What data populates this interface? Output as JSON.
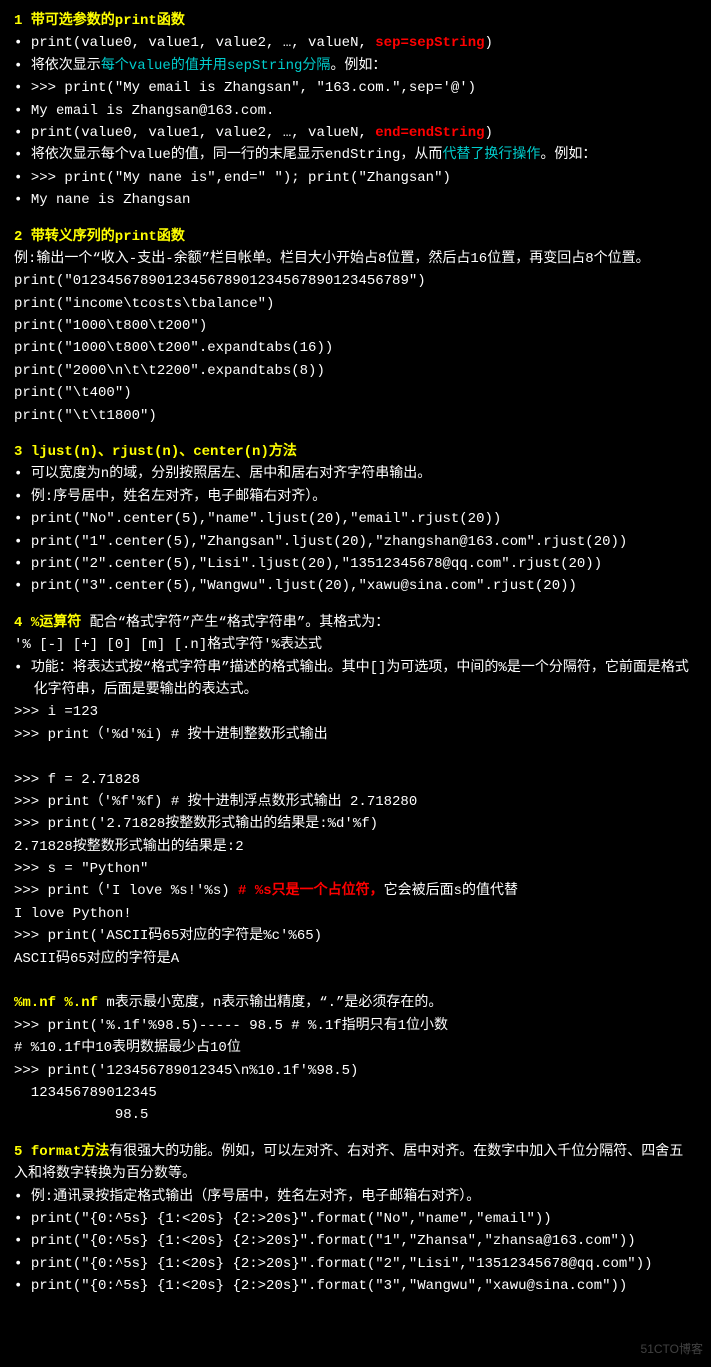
{
  "sec1": {
    "title_num": "1",
    "title_text": "带可选参数的print函数",
    "b1a": "print(value0, value1, value2, …, valueN, ",
    "b1b": "sep=sepString",
    "b1c": ")",
    "b2a": "将依次显示",
    "b2b": "每个value的值并用sepString分隔",
    "b2c": "。例如：",
    "b3": ">>> print(\"My email is Zhangsan\", \"163.com.\",sep='@')",
    "b4": "My email is Zhangsan@163.com.",
    "b5a": "print(value0, value1, value2, …, valueN, ",
    "b5b": "end=endString",
    "b5c": ")",
    "b6a": "将依次显示每个value的值，同一行的末尾显示endString，从而",
    "b6b": "代替了换行操作",
    "b6c": "。例如：",
    "b7": ">>> print(\"My nane is\",end=\" \"); print(\"Zhangsan\")",
    "b8": "My nane is Zhangsan"
  },
  "sec2": {
    "title_num": "2",
    "title_text": "带转义序列的print函数",
    "l1": "例:输出一个“收入-支出-余额”栏目帐单。栏目大小开始占8位置，然后占16位置，再变回占8个位置。print(\"0123456789012345678901234567890123456789\")",
    "l2": "print(\"income\\tcosts\\tbalance\")",
    "l3": "print(\"1000\\t800\\t200\")",
    "l4": "print(\"1000\\t800\\t200\".expandtabs(16))",
    "l5": "print(\"2000\\n\\t\\t2200\".expandtabs(8))",
    "l6": "print(\"\\t400\")",
    "l7": "print(\"\\t\\t1800\")"
  },
  "sec3": {
    "title_num": "3",
    "title_text": "ljust(n)、rjust(n)、center(n)方法",
    "b1": "可以宽度为n的域，分别按照居左、居中和居右对齐字符串输出。",
    "b2": "例:序号居中，姓名左对齐，电子邮箱右对齐）。",
    "b3": "print(\"No\".center(5),\"name\".ljust(20),\"email\".rjust(20))",
    "b4": "print(\"1\".center(5),\"Zhangsan\".ljust(20),\"zhangshan@163.com\".rjust(20))",
    "b5": "print(\"2\".center(5),\"Lisi\".ljust(20),\"13512345678@qq.com\".rjust(20))",
    "b6": "print(\"3\".center(5),\"Wangwu\".ljust(20),\"xawu@sina.com\".rjust(20))"
  },
  "sec4": {
    "title_num": "4",
    "title_text": "%运算符",
    "title_rest": " 配合“格式字符”产生“格式字符串”。其格式为：",
    "fmt": "'% [-] [+] [0] [m] [.n]格式字符'%表达式",
    "b1": "功能：将表达式按“格式字符串”描述的格式输出。其中[]为可选项，中间的%是一个分隔符，它前面是格式化字符串，后面是要输出的表达式。",
    "l1": ">>> i =123",
    "l2": ">>> print（'%d'%i)          # 按十进制整数形式输出",
    "l3": ">>> f = 2.71828",
    "l4": ">>> print（'%f'%f)         # 按十进制浮点数形式输出  2.718280",
    "l5": ">>> print('2.71828按整数形式输出的结果是:%d'%f)",
    "l6": "2.71828按整数形式输出的结果是:2",
    "l7": ">>> s = \"Python\"",
    "l8a": ">>> print（'I love %s!'%s)  ",
    "l8b": "# %s只是一个占位符，",
    "l8c": "它会被后面s的值代替",
    "l9": "I love Python!",
    "l10": ">>> print('ASCII码65对应的字符是%c'%65)",
    "l11": "ASCII码65对应的字符是A",
    "mn1": "%m.nf   %.nf",
    "mn2": "   m表示最小宽度，n表示输出精度，“.”是必须存在的。",
    "l12": ">>> print('%.1f'%98.5)----- 98.5  # %.1f指明只有1位小数",
    "l13": "# %10.1f中10表明数据最少占10位",
    "l14": ">>> print('123456789012345\\n%10.1f'%98.5)",
    "l15": "  123456789012345",
    "l16": "            98.5"
  },
  "sec5": {
    "title_num": "5",
    "title_text": "format方法",
    "title_rest": "有很强大的功能。例如，可以左对齐、右对齐、居中对齐。在数字中加入千位分隔符、四舍五入和将数字转换为百分数等。",
    "b1": "例:通讯录按指定格式输出（序号居中，姓名左对齐，电子邮箱右对齐）。",
    "b2": "print(\"{0:^5s} {1:<20s} {2:>20s}\".format(\"No\",\"name\",\"email\"))",
    "b3": "print(\"{0:^5s} {1:<20s} {2:>20s}\".format(\"1\",\"Zhansa\",\"zhansa@163.com\"))",
    "b4": "print(\"{0:^5s} {1:<20s} {2:>20s}\".format(\"2\",\"Lisi\",\"13512345678@qq.com\"))",
    "b5": "print(\"{0:^5s} {1:<20s} {2:>20s}\".format(\"3\",\"Wangwu\",\"xawu@sina.com\"))"
  },
  "watermark": "51CTO博客"
}
